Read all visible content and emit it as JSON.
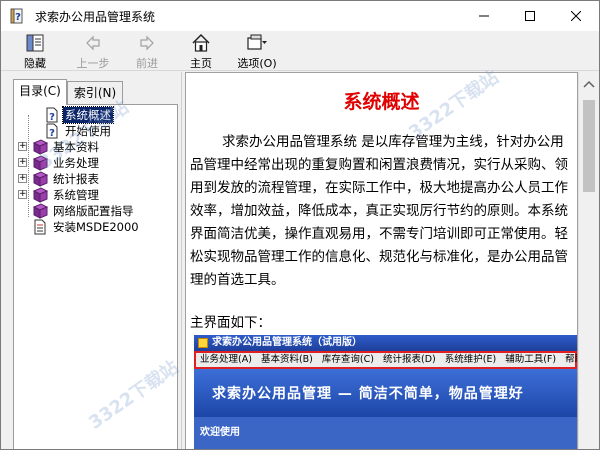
{
  "window": {
    "title": "求索办公用品管理系统",
    "accent": "#0a246a"
  },
  "toolbar": {
    "hide_label": "隐藏",
    "back_label": "上一步",
    "forward_label": "前进",
    "home_label": "主页",
    "options_label": "选项(O)"
  },
  "tabs": {
    "contents_label": "目录(C)",
    "index_label": "索引(N)"
  },
  "tree": {
    "items": [
      {
        "label": "系统概述",
        "icon": "help-page-icon",
        "selected": true
      },
      {
        "label": "开始使用",
        "icon": "help-page-icon"
      },
      {
        "label": "基本资料",
        "icon": "book-icon"
      },
      {
        "label": "业务处理",
        "icon": "book-icon"
      },
      {
        "label": "统计报表",
        "icon": "book-icon"
      },
      {
        "label": "系统管理",
        "icon": "book-icon"
      },
      {
        "label": "网络版配置指导",
        "icon": "book-icon"
      },
      {
        "label": "安装MSDE2000",
        "icon": "document-icon"
      }
    ]
  },
  "content": {
    "title": "系统概述",
    "title_color": "#e00000",
    "paragraph": "求索办公用品管理系统 是以库存管理为主线，针对办公用品管理中经常出现的重复购置和闲置浪费情况，实行从采购、领用到发放的流程管理，在实际工作中，极大地提高办公人员工作效率，增加效益，降低成本，真正实现厉行节约的原则。本系统界面简洁优美，操作直观易用，不需专门培训即可正常使用。轻松实现物品管理工作的信息化、规范化与标准化，是办公用品管理的首选工具。",
    "subheading": "主界面如下："
  },
  "embedded": {
    "title": "求索办公用品管理系统（试用版）",
    "menu": [
      "业务处理(A)",
      "基本资料(B)",
      "库存查询(C)",
      "统计报表(D)",
      "系统维护(E)",
      "辅助工具(F)",
      "帮助(H)"
    ],
    "banner": "求索办公用品管理 — 简洁不简单，物品管理好",
    "welcome": "欢迎使用"
  },
  "watermark": "3322下载站"
}
